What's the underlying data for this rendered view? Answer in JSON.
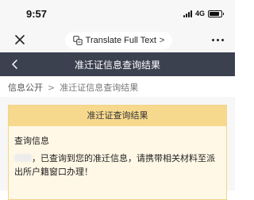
{
  "status_bar": {
    "time": "9:57",
    "network": "4G",
    "battery_level": 0.85
  },
  "browser_bar": {
    "translate_label": "Translate Full Text",
    "translate_chevron": ">"
  },
  "title_bar": {
    "title": "准迁证信息查询结果"
  },
  "breadcrumb": {
    "root": "信息公开",
    "separator": ">",
    "current": "准迁证信息查询结果"
  },
  "result_card": {
    "header": "准迁证查询结果",
    "section_title": "查询信息",
    "message": "，已查询到您的准迁信息，请携带相关材料至派出所户籍窗口办理！"
  },
  "colors": {
    "title_bar_bg": "#3c4150",
    "card_header_bg": "#f7d98e",
    "card_bg": "#fff8e6"
  }
}
